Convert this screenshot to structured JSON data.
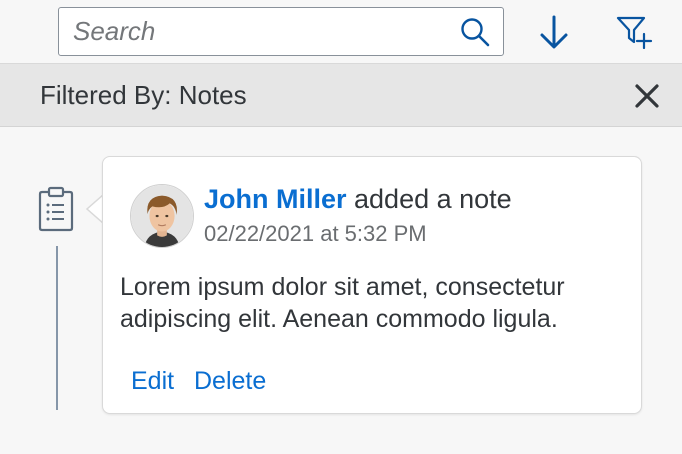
{
  "toolbar": {
    "search": {
      "placeholder": "Search",
      "value": ""
    },
    "icons": {
      "search": "search-icon",
      "sort": "sort-descending-icon",
      "filter": "add-filter-icon"
    }
  },
  "filter_bar": {
    "text": "Filtered By: Notes",
    "close_icon": "close-icon"
  },
  "timeline": {
    "item": {
      "type_icon": "clipboard-note-icon",
      "author": "John Miller",
      "action": " added a note",
      "timestamp": "02/22/2021 at 5:32 PM",
      "body": "Lorem ipsum dolor sit amet, consectetur adipiscing elit. Aenean commodo ligula.",
      "actions": {
        "edit": "Edit",
        "delete": "Delete"
      }
    }
  },
  "colors": {
    "link": "#0a6ed1",
    "text": "#32363a",
    "secondary_text": "#6a6d70",
    "background": "#f7f7f7",
    "filter_bar": "#e6e6e6",
    "icon": "#0854a0"
  }
}
